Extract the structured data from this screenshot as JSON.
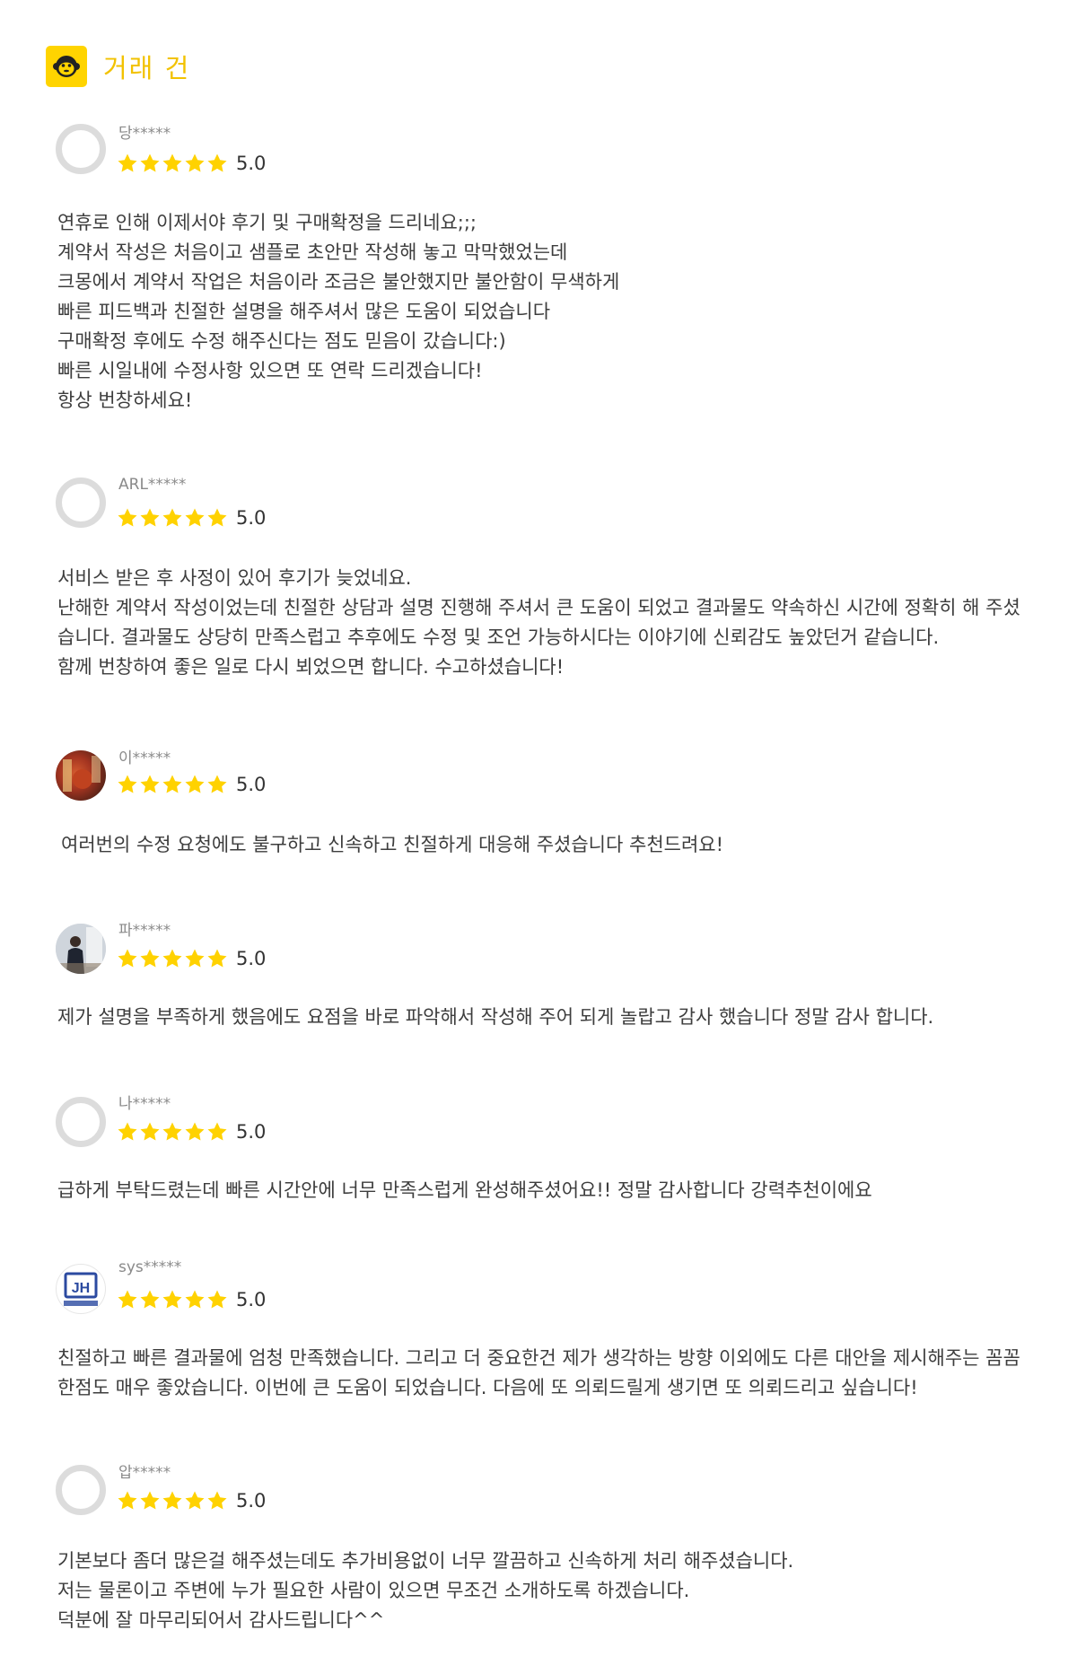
{
  "header": {
    "title": "거래 건",
    "icon": "monkey-icon",
    "accent": "#ffd400"
  },
  "star_color": "#ffd200",
  "reviews": [
    {
      "user": "당*****",
      "rating": 5,
      "score": "5.0",
      "text": "연휴로 인해 이제서야 후기 및 구매확정을 드리네요;;;\n계약서 작성은 처음이고 샘플로 초안만 작성해 놓고 막막했었는데\n크몽에서 계약서 작업은 처음이라 조금은 불안했지만 불안함이 무색하게\n빠른 피드백과 친절한 설명을 해주셔서 많은 도움이 되었습니다\n구매확정 후에도 수정 해주신다는 점도 믿음이 갔습니다:)\n빠른 시일내에 수정사항 있으면 또 연락 드리겠습니다!\n항상 번창하세요!"
    },
    {
      "user": "ARL*****",
      "rating": 5,
      "score": "5.0",
      "text": "서비스 받은 후 사정이 있어 후기가 늦었네요.\n난해한 계약서 작성이었는데 친절한 상담과 설명 진행해 주셔서 큰 도움이 되었고 결과물도 약속하신 시간에 정확히 해 주셨습니다. 결과물도 상당히 만족스럽고 추후에도 수정 및 조언 가능하시다는 이야기에 신뢰감도 높았던거 같습니다.\n함께 번창하여 좋은 일로 다시 뵈었으면 합니다. 수고하셨습니다!"
    },
    {
      "user": "이*****",
      "rating": 5,
      "score": "5.0",
      "text": "여러번의 수정 요청에도 불구하고 신속하고 친절하게 대응해 주셨습니다 추천드려요!"
    },
    {
      "user": "파*****",
      "rating": 5,
      "score": "5.0",
      "text": "제가 설명을 부족하게 했음에도 요점을 바로 파악해서 작성해 주어 되게 놀랍고 감사 했습니다 정말 감사 합니다."
    },
    {
      "user": "나*****",
      "rating": 5,
      "score": "5.0",
      "text": "급하게 부탁드렸는데 빠른 시간안에 너무 만족스럽게 완성해주셨어요!! 정말 감사합니다 강력추천이에요"
    },
    {
      "user": "sys*****",
      "rating": 5,
      "score": "5.0",
      "text": "친절하고 빠른 결과물에 엄청 만족했습니다. 그리고 더 중요한건 제가 생각하는 방향 이외에도 다른 대안을 제시해주는 꼼꼼한점도 매우 좋았습니다. 이번에 큰 도움이 되었습니다. 다음에 또 의뢰드릴게 생기면 또 의뢰드리고 싶습니다!"
    },
    {
      "user": "압*****",
      "rating": 5,
      "score": "5.0",
      "text": "기본보다 좀더 많은걸 해주셨는데도 추가비용없이 너무 깔끔하고 신속하게 처리 해주셨습니다.\n저는 물론이고 주변에 누가 필요한 사람이 있으면 무조건 소개하도록 하겠습니다.\n덕분에 잘 마무리되어서 감사드립니다^^"
    }
  ]
}
